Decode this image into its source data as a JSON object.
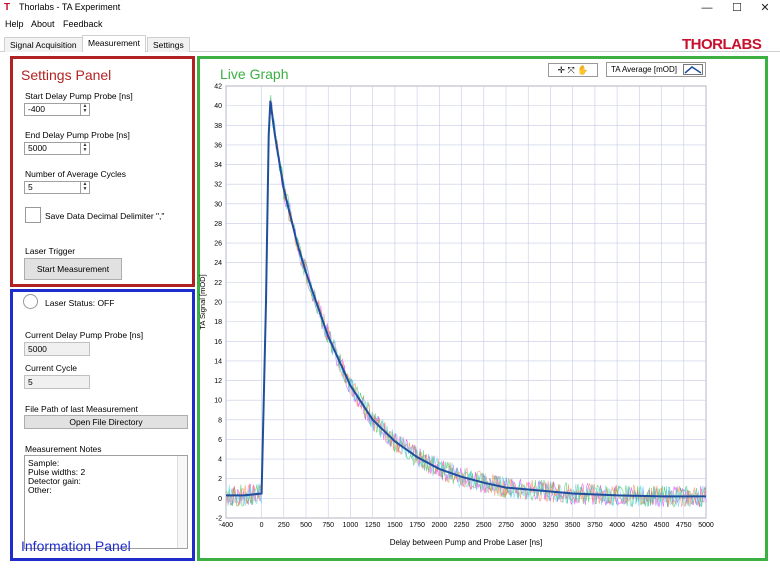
{
  "window": {
    "title": "Thorlabs - TA Experiment",
    "icon": "thorlabs-t-icon",
    "controls": [
      "—",
      "☐",
      "✕"
    ]
  },
  "menu": [
    "Help",
    "About",
    "Feedback"
  ],
  "tabs": [
    {
      "label": "Signal Acquisition",
      "active": false
    },
    {
      "label": "Measurement",
      "active": true
    },
    {
      "label": "Settings",
      "active": false
    }
  ],
  "logo": "THORLABS",
  "settings_panel": {
    "title": "Settings Panel",
    "start_delay_label": "Start Delay Pump Probe [ns]",
    "start_delay_value": "-400",
    "end_delay_label": "End Delay Pump Probe [ns]",
    "end_delay_value": "5000",
    "avg_cycles_label": "Number of Average Cycles",
    "avg_cycles_value": "5",
    "decimal_label": "Save Data Decimal Delimiter \",\"",
    "laser_trigger_label": "Laser Trigger",
    "start_button": "Start Measurement"
  },
  "info_panel": {
    "title": "Information Panel",
    "laser_status": "Laser Status: OFF",
    "current_delay_label": "Current Delay Pump Probe [ns]",
    "current_delay_value": "5000",
    "current_cycle_label": "Current Cycle",
    "current_cycle_value": "5",
    "file_path_label": "File Path of last Measurement",
    "open_dir_button": "Open File Directory",
    "notes_label": "Measurement Notes",
    "notes_lines": [
      "Sample:",
      "Pulse widths: 2",
      "Detector gain:",
      "Other:"
    ]
  },
  "graph_panel": {
    "title": "Live Graph",
    "toolbar_icons": "✛ ⤧ ✋",
    "legend": "TA Average [mOD]"
  },
  "colors": {
    "settings_border": "#b22222",
    "info_border": "#1f2ccc",
    "graph_border": "#3cb043",
    "series": "#1f4e9c"
  },
  "chart_data": {
    "type": "line",
    "title": "",
    "xlabel": "Delay between Pump and Probe Laser [ns]",
    "ylabel": "TA Signal [mOD]",
    "xlim": [
      -400,
      5000
    ],
    "ylim": [
      -2,
      42
    ],
    "xticks": [
      -400,
      0,
      250,
      500,
      750,
      1000,
      1250,
      1500,
      1750,
      2000,
      2250,
      2500,
      2750,
      3000,
      3250,
      3500,
      3750,
      4000,
      4250,
      4500,
      4750,
      5000
    ],
    "yticks": [
      -2,
      0,
      2,
      4,
      6,
      8,
      10,
      12,
      14,
      16,
      18,
      20,
      22,
      24,
      26,
      28,
      30,
      32,
      34,
      36,
      38,
      40,
      42
    ],
    "grid": true,
    "series": [
      {
        "name": "TA Average [mOD]",
        "x": [
          -400,
          -200,
          0,
          50,
          80,
          100,
          150,
          250,
          400,
          500,
          750,
          1000,
          1250,
          1500,
          1750,
          2000,
          2250,
          2500,
          2750,
          3000,
          3500,
          4000,
          4500,
          5000
        ],
        "y": [
          0.3,
          0.3,
          0.5,
          20,
          37,
          40.5,
          37,
          31.5,
          26,
          23,
          16.5,
          11.5,
          8,
          5.8,
          4.2,
          3.0,
          2.2,
          1.6,
          1.1,
          0.9,
          0.5,
          0.3,
          0.2,
          0.2
        ]
      }
    ]
  }
}
